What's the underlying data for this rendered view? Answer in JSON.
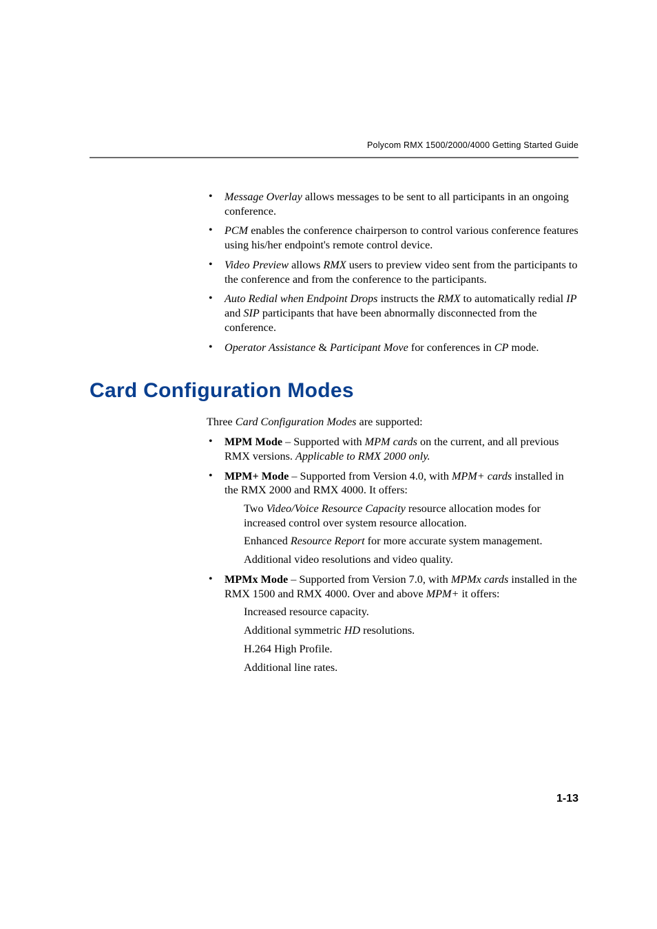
{
  "running_header": "Polycom RMX 1500/2000/4000 Getting Started Guide",
  "top_bullets": [
    {
      "lead_i": "Message Overlay",
      "rest": " allows messages to be sent to all participants in an ongoing conference."
    },
    {
      "lead_i": "PCM",
      "rest": " enables the conference chairperson to control various conference features using his/her endpoint's remote control device."
    },
    {
      "lead_i": "Video Preview",
      "mid": " allows ",
      "mid_i": "RMX",
      "rest": " users to preview video sent from the participants to the conference and from the conference to the participants."
    },
    {
      "lead_i": "Auto Redial when Endpoint Drops",
      "mid": " instructs the ",
      "mid_i": "RMX",
      "mid2": " to automatically redial ",
      "mid2_i": "IP",
      "mid3": " and ",
      "mid3_i": "SIP",
      "rest": " participants that have been abnormally disconnected from the conference."
    },
    {
      "lead_i": "Operator Assistance",
      "mid": " & ",
      "mid_i": "Participant Move",
      "mid2": " for conferences in ",
      "mid2_i": "CP",
      "rest": " mode."
    }
  ],
  "section_title": "Card Configuration Modes",
  "intro_pre": "Three ",
  "intro_i": "Card Configuration Modes",
  "intro_post": " are supported:",
  "modes": [
    {
      "name": "MPM Mode",
      "dash": " – Supported with ",
      "i1": "MPM cards",
      "mid": " on the current, and all previous RMX versions. ",
      "tail_i": "Applicable to RMX 2000 only.",
      "tail": ""
    },
    {
      "name": "MPM+ Mode",
      "dash": " – Supported from Version 4.0, with ",
      "i1": "MPM+ cards",
      "mid": " installed in the RMX 2000 and RMX 4000. It offers:",
      "sub": [
        {
          "pre": "Two ",
          "i": "Video/Voice Resource Capacity",
          "post": " resource allocation modes for increased control over system resource allocation."
        },
        {
          "pre": "Enhanced ",
          "i": "Resource Report",
          "post": " for more accurate system management."
        },
        {
          "pre": "",
          "i": "",
          "post": "Additional video resolutions and video quality."
        }
      ]
    },
    {
      "name": "MPMx Mode",
      "dash": " – Supported from Version 7.0, with ",
      "i1": "MPMx cards",
      "mid": " installed in the RMX 1500 and RMX 4000. Over and above ",
      "i2": "MPM+",
      "tail": " it offers:",
      "sub": [
        {
          "pre": "",
          "i": "",
          "post": "Increased resource capacity."
        },
        {
          "pre": "Additional symmetric ",
          "i": "HD",
          "post": " resolutions."
        },
        {
          "pre": "",
          "i": "",
          "post": "H.264 High Profile."
        },
        {
          "pre": "",
          "i": "",
          "post": "Additional line rates."
        }
      ]
    }
  ],
  "page_num": "1-13"
}
